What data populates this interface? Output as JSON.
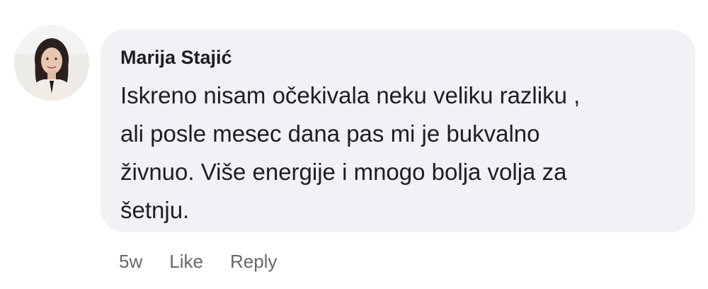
{
  "comment": {
    "author": "Marija Stajić",
    "text": "Iskreno nisam očekivala neku veliku razliku ,\nali posle mesec dana pas mi je bukvalno\nživnuo. Više energije i mnogo bolja volja za\nšetnju.",
    "avatar_icon": "profile-photo"
  },
  "actions": {
    "time": "5w",
    "like": "Like",
    "reply": "Reply"
  },
  "colors": {
    "bubble_bg": "#f0f2f5",
    "text": "#1c1e21",
    "meta": "#65676b"
  }
}
